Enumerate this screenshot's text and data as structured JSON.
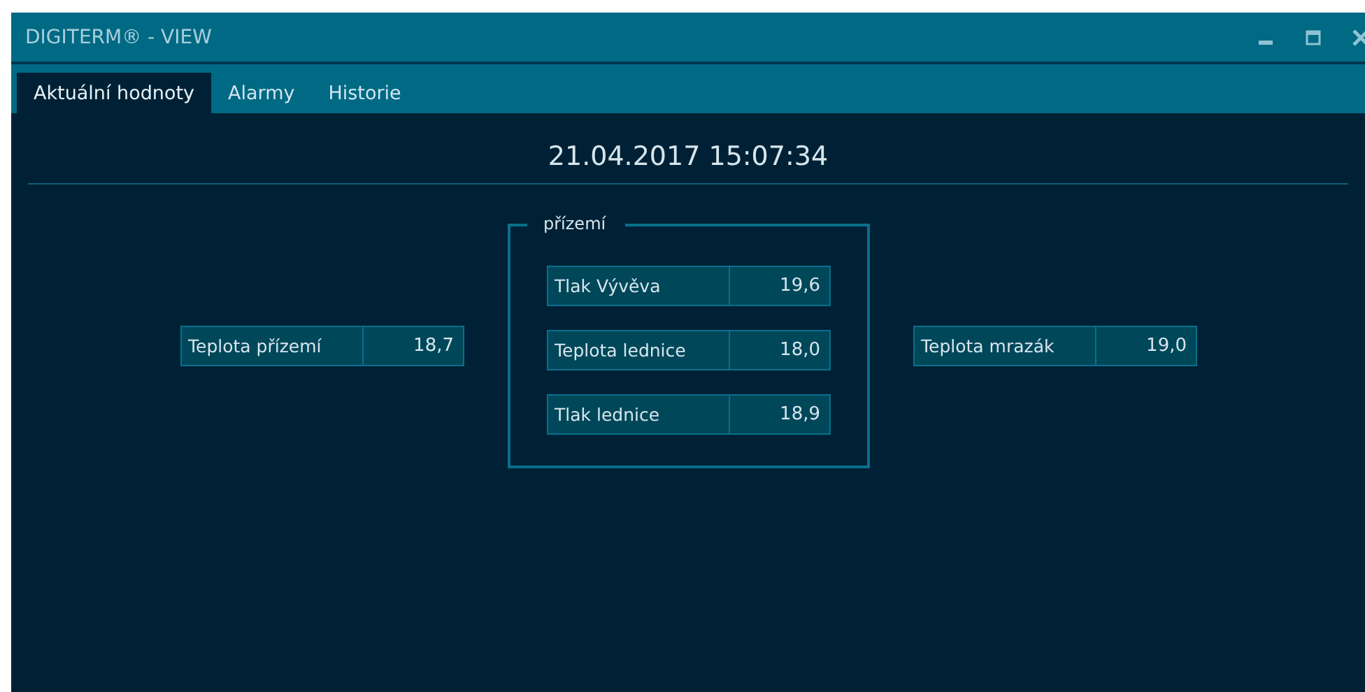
{
  "window": {
    "title": "DIGITERM® - VIEW"
  },
  "tabs": [
    {
      "label": "Aktuální hodnoty",
      "selected": true
    },
    {
      "label": "Alarmy",
      "selected": false
    },
    {
      "label": "Historie",
      "selected": false
    }
  ],
  "timestamp": "21.04.2017 15:07:34",
  "left_readings": [
    {
      "label": "Teplota přízemí",
      "value": "18,7"
    }
  ],
  "group": {
    "title": "přízemí",
    "readings": [
      {
        "label": "Tlak Vývěva",
        "value": "19,6"
      },
      {
        "label": "Teplota lednice",
        "value": "18,0"
      },
      {
        "label": "Tlak lednice",
        "value": "18,9"
      }
    ]
  },
  "right_readings": [
    {
      "label": "Teplota mrazák",
      "value": "19,0"
    }
  ]
}
